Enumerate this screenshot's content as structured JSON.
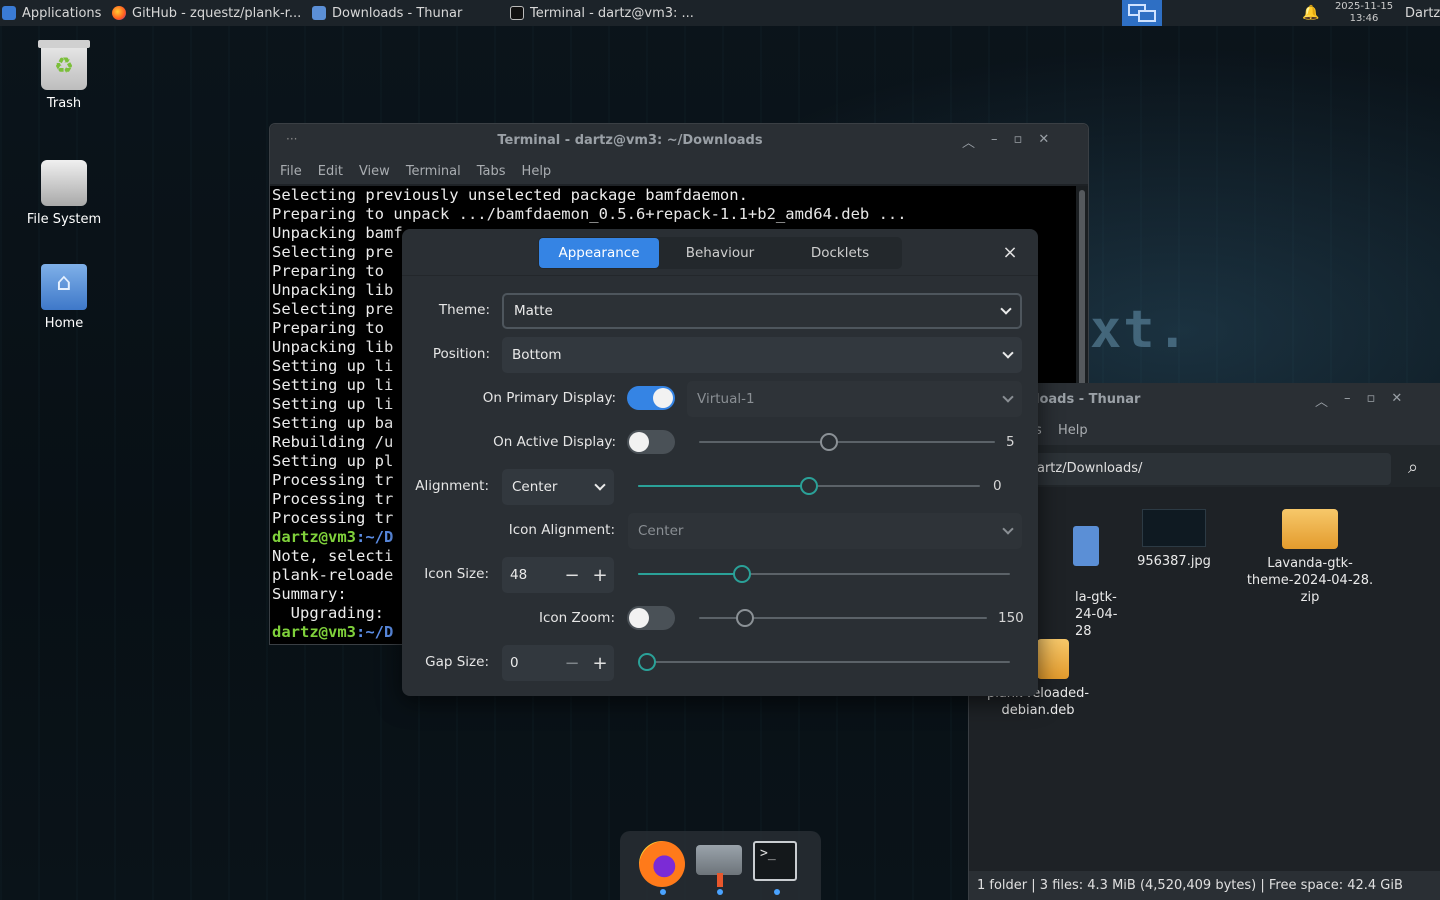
{
  "top_panel": {
    "apps_label": "Applications",
    "tasks": [
      {
        "label": "GitHub - zquestz/plank-r...",
        "icon": "firefox-icon"
      },
      {
        "label": "Downloads - Thunar",
        "icon": "folder-icon"
      },
      {
        "label": "Terminal - dartz@vm3: ...",
        "icon": "terminal-icon"
      }
    ],
    "date": "2025-11-15",
    "time": "13:46",
    "user": "Dartz"
  },
  "desktop": {
    "icons": [
      {
        "label": "Trash"
      },
      {
        "label": "File System"
      },
      {
        "label": "Home"
      }
    ],
    "wallpaper_text": "xt."
  },
  "terminal": {
    "title": "Terminal - dartz@vm3: ~/Downloads",
    "menu": [
      "File",
      "Edit",
      "View",
      "Terminal",
      "Tabs",
      "Help"
    ],
    "lines": [
      "Selecting previously unselected package bamfdaemon.",
      "Preparing to unpack .../bamfdaemon_0.5.6+repack-1.1+b2_amd64.deb ...",
      "Unpacking bamf",
      "Selecting pre",
      "Preparing to",
      "Unpacking lib",
      "Selecting pre",
      "Preparing to",
      "Unpacking lib",
      "Setting up li",
      "Setting up li",
      "Setting up li",
      "Setting up ba",
      "Rebuilding /u",
      "Setting up pl",
      "Processing tr",
      "Processing tr",
      "Processing tr"
    ],
    "prompt_user": "dartz@vm3",
    "prompt_path": ":~/D",
    "after_prompt_lines": [
      "Note, selecti",
      "plank-reloade",
      "Summary:",
      "  Upgrading:"
    ]
  },
  "thunar": {
    "title": "loads - Thunar",
    "menu_visible": [
      "s",
      "Help"
    ],
    "path": "artz/Downloads/",
    "files": [
      {
        "name": "la-gtk-\n24-04-28",
        "type": "folder"
      },
      {
        "name": "956387.jpg",
        "type": "image"
      },
      {
        "name": "Lavanda-gtk-\ntheme-2024-04-28.\nzip",
        "type": "archive"
      },
      {
        "name": "plank-reloaded-\ndebian.deb",
        "type": "package"
      }
    ],
    "status": "1 folder  |  3 files: 4.3 MiB (4,520,409 bytes)  |  Free space: 42.4 GiB"
  },
  "plank_prefs": {
    "tabs": [
      "Appearance",
      "Behaviour",
      "Docklets"
    ],
    "active_tab": "Appearance",
    "theme": {
      "label": "Theme:",
      "value": "Matte"
    },
    "position": {
      "label": "Position:",
      "value": "Bottom"
    },
    "primary_display": {
      "label": "On Primary Display:",
      "enabled": true,
      "monitor": "Virtual-1"
    },
    "active_display": {
      "label": "On Active Display:",
      "enabled": false,
      "value": "5",
      "fraction": 0.44
    },
    "alignment": {
      "label": "Alignment:",
      "value": "Center",
      "offset": "0",
      "fraction": 0.5
    },
    "icon_alignment": {
      "label": "Icon Alignment:",
      "value": "Center"
    },
    "icon_size": {
      "label": "Icon Size:",
      "value": "48",
      "fraction": 0.28
    },
    "icon_zoom": {
      "label": "Icon Zoom:",
      "enabled": false,
      "value": "150",
      "fraction": 0.16
    },
    "gap_size": {
      "label": "Gap Size:",
      "value": "0",
      "fraction": 0.0
    },
    "colors": {
      "accent": "#3584e4",
      "teal": "#2aa198"
    }
  },
  "dock": {
    "items": [
      "firefox-icon",
      "plank-settings-icon",
      "terminal-icon"
    ]
  }
}
